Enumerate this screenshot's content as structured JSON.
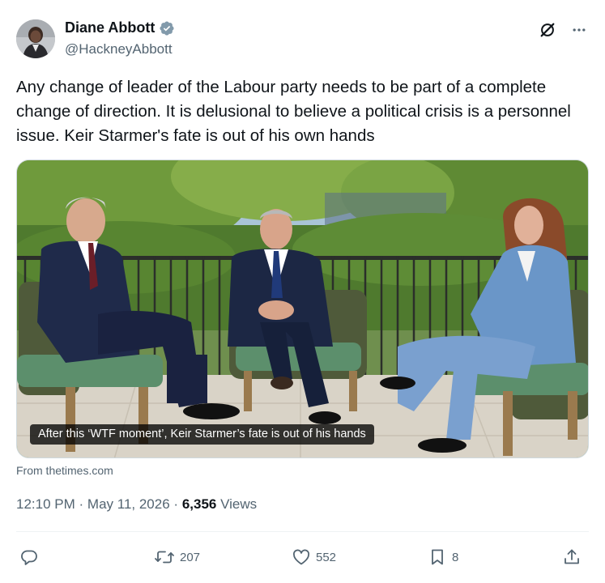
{
  "author": {
    "display_name": "Diane Abbott",
    "handle": "@HackneyAbbott",
    "verified": true
  },
  "tweet": {
    "text": "Any change of leader of the Labour party needs to be part of a complete change of direction. It is delusional to believe a political crisis is a personnel issue. Keir Starmer's fate is out of his own hands"
  },
  "media": {
    "caption": "After this ‘WTF moment’, Keir Starmer’s fate is out of his hands",
    "source": "From thetimes.com"
  },
  "meta": {
    "time": "12:10 PM",
    "separator": "·",
    "date": "May 11, 2026",
    "views_count": "6,356",
    "views_label": "Views"
  },
  "actions": {
    "replies": "",
    "reposts": "207",
    "likes": "552",
    "bookmarks": "8"
  },
  "icons": {
    "verified": "verified-badge-icon",
    "grok": "grok-icon",
    "more": "more-icon",
    "reply": "reply-icon",
    "repost": "repost-icon",
    "like": "like-icon",
    "bookmark": "bookmark-icon",
    "share": "share-icon"
  },
  "colors": {
    "text": "#0f1419",
    "secondary": "#536471",
    "verified": "#829aab",
    "divider": "#eff3f4"
  }
}
